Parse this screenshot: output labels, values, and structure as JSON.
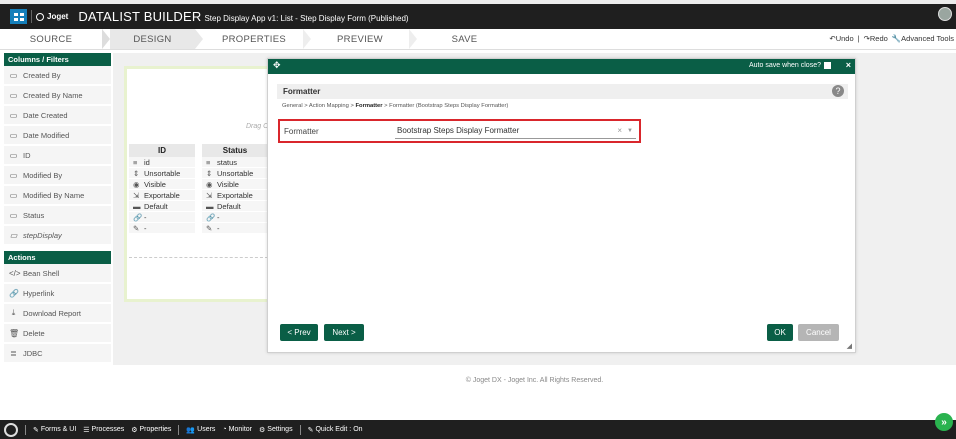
{
  "header": {
    "brand": "Joget",
    "title": "DATALIST BUILDER",
    "subtitle": "Step Display App v1: List - Step Display Form (Published)"
  },
  "tabs": [
    "SOURCE",
    "DESIGN",
    "PROPERTIES",
    "PREVIEW",
    "SAVE"
  ],
  "active_tab": "DESIGN",
  "toolbar": {
    "undo": "Undo",
    "sep": "|",
    "redo": "Redo",
    "advanced": "Advanced Tools"
  },
  "palette": {
    "columns_header": "Columns / Filters",
    "columns": [
      {
        "label": "Created By",
        "icon": "table-icon"
      },
      {
        "label": "Created By Name",
        "icon": "table-icon"
      },
      {
        "label": "Date Created",
        "icon": "table-icon"
      },
      {
        "label": "Date Modified",
        "icon": "table-icon"
      },
      {
        "label": "ID",
        "icon": "table-icon"
      },
      {
        "label": "Modified By",
        "icon": "table-icon"
      },
      {
        "label": "Modified By Name",
        "icon": "table-icon"
      },
      {
        "label": "Status",
        "icon": "table-icon"
      },
      {
        "label": "stepDisplay",
        "icon": "table-icon"
      }
    ],
    "actions_header": "Actions",
    "actions": [
      {
        "label": "Bean Shell",
        "icon": "code-icon"
      },
      {
        "label": "Hyperlink",
        "icon": "link-icon"
      },
      {
        "label": "Download Report",
        "icon": "download-icon"
      },
      {
        "label": "Delete",
        "icon": "trash-icon"
      },
      {
        "label": "JDBC",
        "icon": "database-icon"
      }
    ]
  },
  "canvas": {
    "drag_hint": "Drag C",
    "columns": [
      {
        "header": "ID",
        "name": "id",
        "sortable": "Unsortable",
        "visible": "Visible",
        "exportable": "Exportable",
        "format": "Default",
        "link": "-",
        "edit": "-"
      },
      {
        "header": "Status",
        "name": "status",
        "sortable": "Unsortable",
        "visible": "Visible",
        "exportable": "Exportable",
        "format": "Default",
        "link": "-",
        "edit": "-"
      }
    ]
  },
  "dialog": {
    "autosave_label": "Auto save when close?",
    "close": "×",
    "header": "Formatter",
    "help": "?",
    "breadcrumb_pre": "General > Action Mapping > ",
    "breadcrumb_current": "Formatter",
    "breadcrumb_post": " > Formatter (Bootstrap Steps Display Formatter)",
    "field_label": "Formatter",
    "field_value": "Bootstrap Steps Display Formatter",
    "clear": "×",
    "prev_label": "< Prev",
    "next_label": "Next >",
    "ok_label": "OK",
    "cancel_label": "Cancel"
  },
  "footer": {
    "copyright": "© Joget DX - Joget Inc. All Rights Reserved."
  },
  "bottombar": {
    "items": [
      "Forms & UI",
      "Processes",
      "Properties",
      "Users",
      "Monitor",
      "Settings",
      "Quick Edit : On"
    ]
  },
  "colors": {
    "dialog_green": "#0a5e46",
    "highlight_red": "#d9262c",
    "canvas_border": "#e8f2cf",
    "expand_green": "#2ab34f"
  }
}
